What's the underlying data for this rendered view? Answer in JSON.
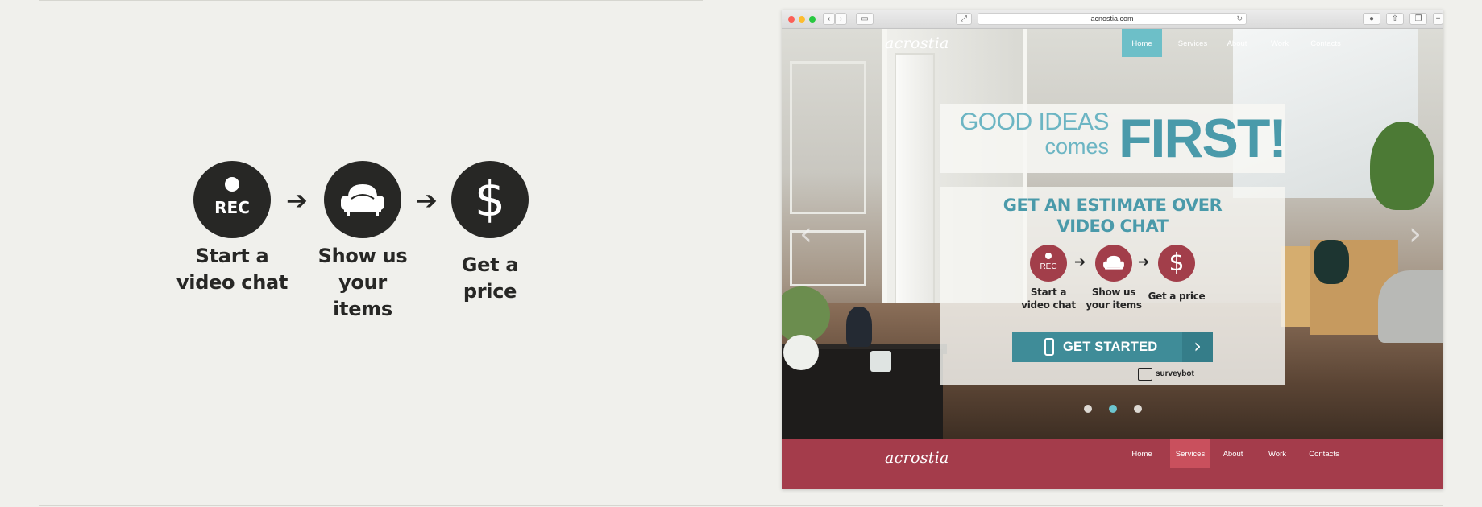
{
  "steps": [
    {
      "icon": "rec-icon",
      "badge": "REC",
      "line1": "Start a",
      "line2": "video chat"
    },
    {
      "icon": "sofa-icon",
      "line1": "Show us",
      "line2": "your items"
    },
    {
      "icon": "dollar-icon",
      "glyph": "$",
      "line1": "Get a price"
    }
  ],
  "arrow_glyph": "➔",
  "browser": {
    "url": "acnostia.com",
    "logo": "acrostia",
    "nav": [
      "Home",
      "Services",
      "About",
      "Work",
      "Contacts"
    ],
    "nav_active": "Home",
    "headline": {
      "good": "GOOD IDEAS",
      "comes": "comes",
      "first": "FIRST!"
    },
    "estimate_title_1": "GET AN ESTIMATE OVER",
    "estimate_title_2": "VIDEO CHAT",
    "cta_label": "GET STARTED",
    "powered_by": "surveybot",
    "slider_dots": 3,
    "slider_active_index": 1,
    "footer": {
      "logo": "acrostia",
      "nav": [
        "Home",
        "Services",
        "About",
        "Work",
        "Contacts"
      ],
      "nav_active": "Services"
    }
  },
  "colors": {
    "background": "#f0f0ec",
    "icon_dark": "#272725",
    "teal": "#4a9aaa",
    "teal_light": "#6dbfc8",
    "brand_red": "#a43c4b"
  }
}
